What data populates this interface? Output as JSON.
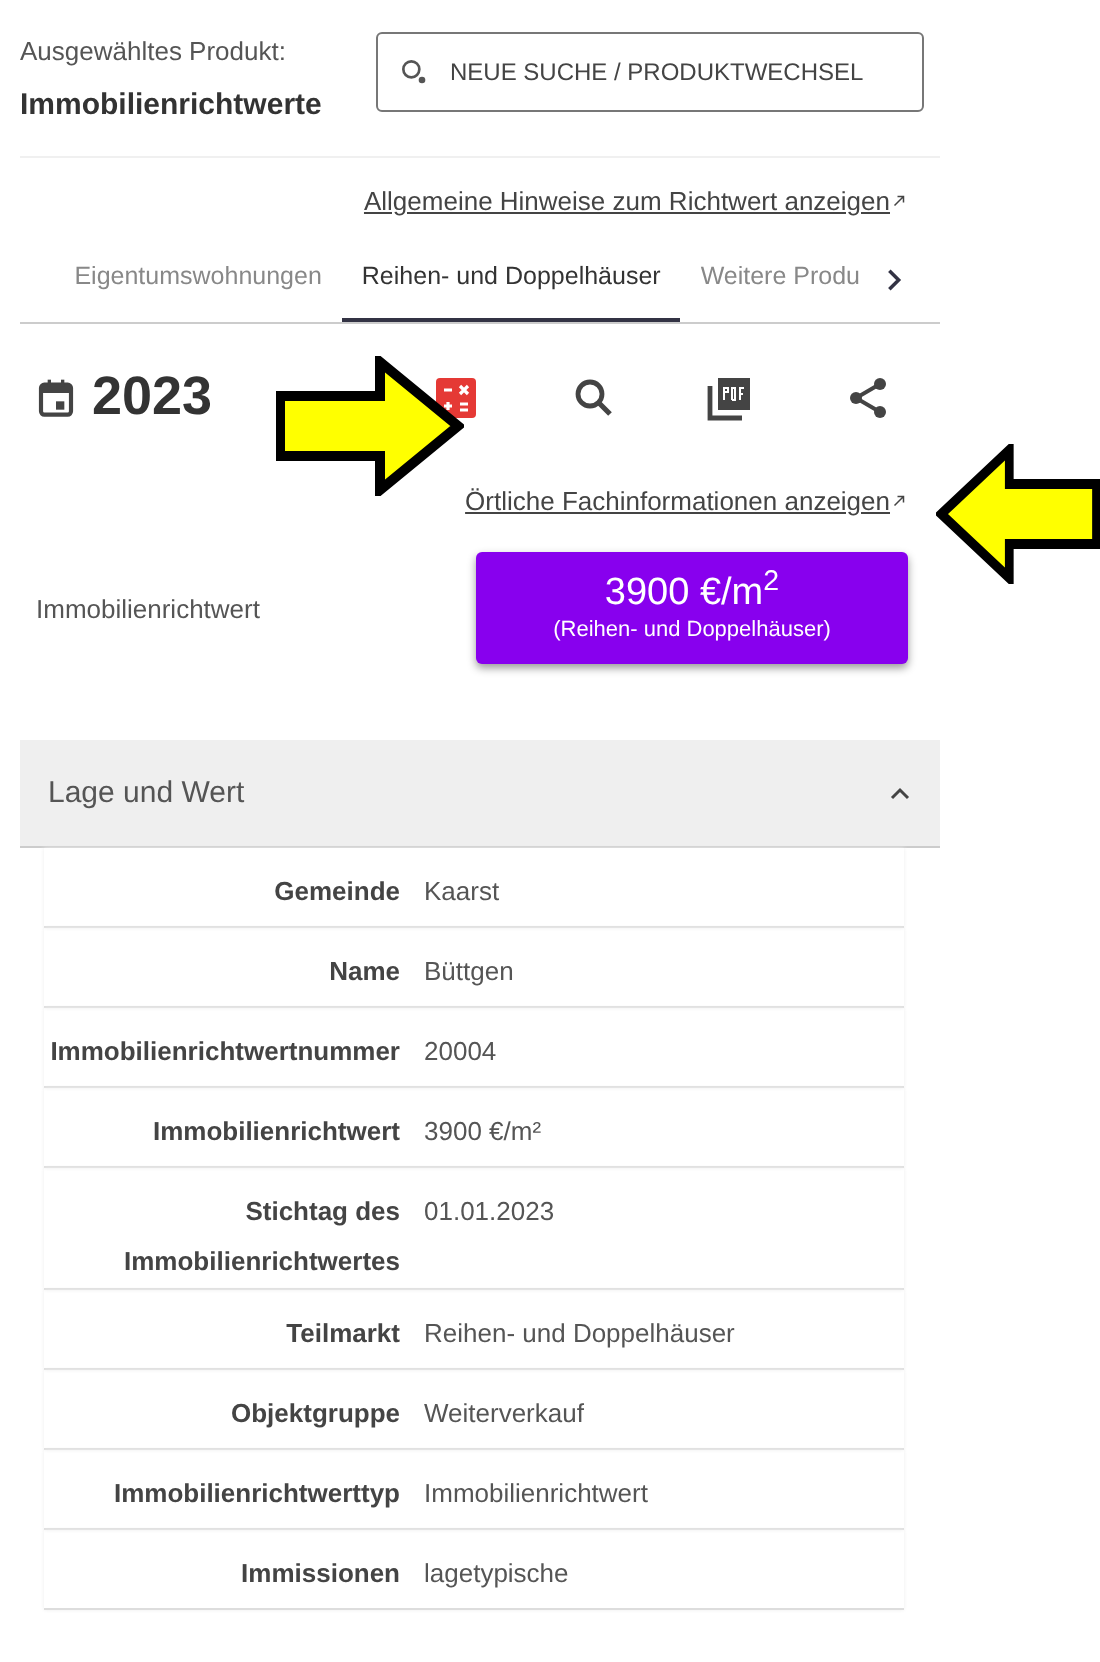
{
  "product": {
    "label": "Ausgewähltes Produkt:",
    "name": "Immobilienrichtwerte"
  },
  "search_button": {
    "label": "NEUE SUCHE / PRODUKTWECHSEL"
  },
  "general_link": "Allgemeine Hinweise zum Richtwert anzeigen",
  "tabs": [
    {
      "label": "Eigentumswohnungen",
      "selected": false
    },
    {
      "label": "Reihen- und Doppelhäuser",
      "selected": true
    },
    {
      "label": "Weitere Produ",
      "selected": false
    }
  ],
  "year": "2023",
  "toolbar": [
    {
      "kind": "calculator"
    },
    {
      "kind": "search"
    },
    {
      "kind": "pdf"
    },
    {
      "kind": "share"
    }
  ],
  "local_link": "Örtliche Fachinformationen anzeigen",
  "value_row": {
    "label": "Immobilienrichtwert",
    "value": "3900 €/m$^{2}$",
    "subtitle": "(Reihen- und Doppelhäuser)"
  },
  "section": {
    "title": "Lage und Wert",
    "expanded": true,
    "rows": [
      {
        "label": "Gemeinde",
        "value": "Kaarst"
      },
      {
        "label": "Name",
        "value": "Büttgen"
      },
      {
        "label": "Immobilienrichtwertnummer",
        "value": "20004"
      },
      {
        "label": "Immobilienrichtwert",
        "value": "3900 €/m²"
      },
      {
        "label": "Stichtag des Immobilienrichtwertes",
        "value": "01.01.2023"
      },
      {
        "label": "Teilmarkt",
        "value": "Reihen- und Doppelhäuser"
      },
      {
        "label": "Objektgruppe",
        "value": "Weiterverkauf"
      },
      {
        "label": "Immobilienrichtwerttyp",
        "value": "Immobilienrichtwert"
      },
      {
        "label": "Immissionen",
        "value": "lagetypische"
      }
    ]
  },
  "annotations": [
    {
      "kind": "right-arrow"
    },
    {
      "kind": "left-arrow"
    }
  ]
}
